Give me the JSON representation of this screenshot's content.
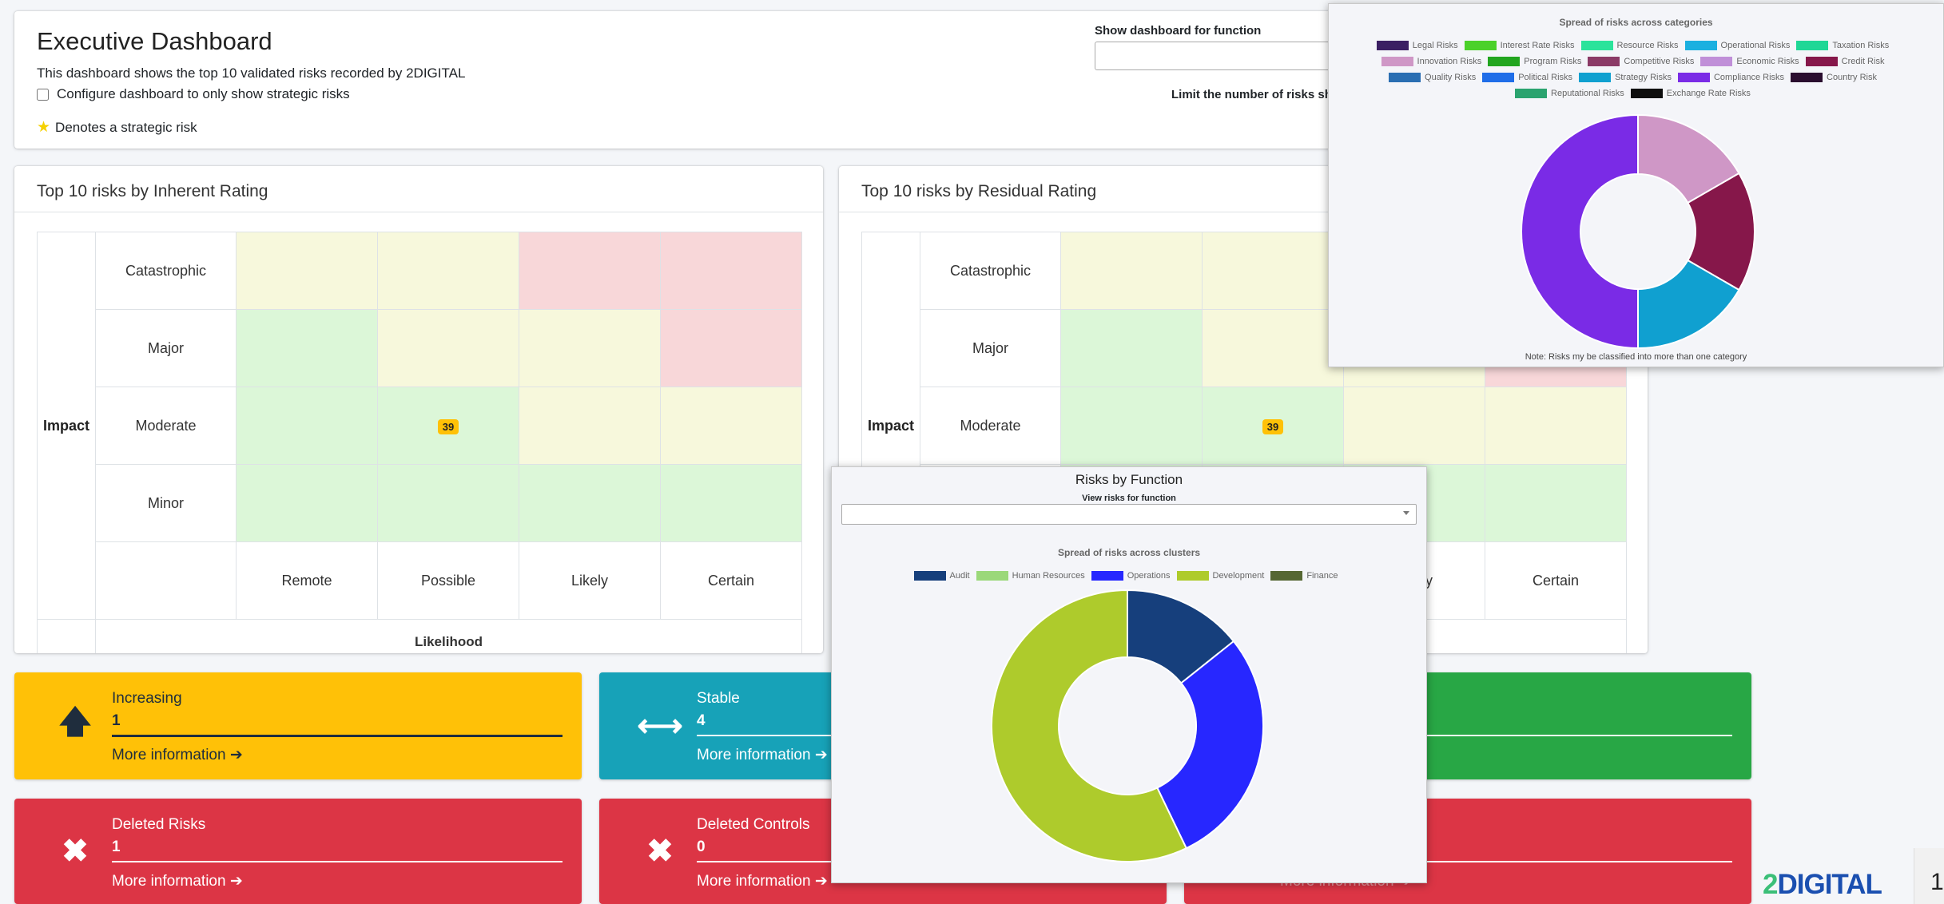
{
  "header": {
    "title": "Executive Dashboard",
    "description": "This dashboard shows the top 10 validated risks recorded by 2DIGITAL",
    "config_label": "Configure dashboard to only show strategic risks",
    "star_note": "Denotes a strategic risk",
    "function_label": "Show dashboard for function",
    "limit_label": "Limit the number of risks show"
  },
  "matrix": {
    "impact_label": "Impact",
    "likelihood_label": "Likelihood",
    "impact_levels": [
      "Catastrophic",
      "Major",
      "Moderate",
      "Minor"
    ],
    "likelihood_levels": [
      "Remote",
      "Possible",
      "Likely",
      "Certain"
    ],
    "ratings": [
      [
        "med",
        "med",
        "high",
        "high"
      ],
      [
        "low",
        "med",
        "med",
        "high"
      ],
      [
        "low",
        "low",
        "med",
        "med"
      ],
      [
        "low",
        "low",
        "low",
        "low"
      ]
    ],
    "colors": {
      "low": "#dcf7d8",
      "med": "#f7f8dc",
      "high": "#f8d7d9"
    }
  },
  "inherent": {
    "title": "Top 10 risks by Inherent Rating",
    "badge": {
      "row": 2,
      "col": 1,
      "value": "39"
    }
  },
  "residual": {
    "title": "Top 10 risks by Residual Rating",
    "badge": {
      "row": 2,
      "col": 1,
      "value": "39"
    }
  },
  "tiles": {
    "increasing": {
      "name": "Increasing",
      "count": "1",
      "more": "More information",
      "icon": "arrow-up-icon"
    },
    "stable": {
      "name": "Stable",
      "count": "4",
      "more": "More information",
      "icon": "arrows-horizontal-icon"
    },
    "deleted_risks": {
      "name": "Deleted Risks",
      "count": "1",
      "more": "More information",
      "icon": "close-icon"
    },
    "deleted_controls": {
      "name": "Deleted Controls",
      "count": "0",
      "more": "More information",
      "icon": "close-icon"
    },
    "partial_more": "More information"
  },
  "brand": {
    "logo_two": "2",
    "logo_text": "DIGITAL",
    "page_number": "1"
  },
  "category_popup": {
    "title": "Spread of risks across categories",
    "note": "Note: Risks my be classified into more than one category",
    "legend": [
      {
        "name": "Legal Risks",
        "color": "#3b1f63"
      },
      {
        "name": "Interest Rate Risks",
        "color": "#4bd12a"
      },
      {
        "name": "Resource Risks",
        "color": "#2be39b"
      },
      {
        "name": "Operational Risks",
        "color": "#1bb0e0"
      },
      {
        "name": "Taxation Risks",
        "color": "#1fd796"
      },
      {
        "name": "Innovation Risks",
        "color": "#cf97c6"
      },
      {
        "name": "Program Risks",
        "color": "#22a51f"
      },
      {
        "name": "Competitive Risks",
        "color": "#8b3a66"
      },
      {
        "name": "Economic Risks",
        "color": "#c08fd8"
      },
      {
        "name": "Credit Risk",
        "color": "#86174a"
      },
      {
        "name": "Quality Risks",
        "color": "#2a6eb2"
      },
      {
        "name": "Political Risks",
        "color": "#1f6de8"
      },
      {
        "name": "Strategy Risks",
        "color": "#10a0d0"
      },
      {
        "name": "Compliance Risks",
        "color": "#7a2be6"
      },
      {
        "name": "Country Risk",
        "color": "#2a0d2f"
      },
      {
        "name": "Reputational Risks",
        "color": "#2aa36f"
      },
      {
        "name": "Exchange Rate Risks",
        "color": "#0e0e0e"
      }
    ]
  },
  "function_popup": {
    "title": "Risks by Function",
    "select_label": "View risks for function",
    "chart_title": "Spread of risks across clusters",
    "legend": [
      {
        "name": "Audit",
        "color": "#163f7c"
      },
      {
        "name": "Human Resources",
        "color": "#9bd87a"
      },
      {
        "name": "Operations",
        "color": "#2727ff"
      },
      {
        "name": "Development",
        "color": "#aecb2c"
      },
      {
        "name": "Finance",
        "color": "#566733"
      }
    ]
  },
  "chart_data": [
    {
      "type": "pie",
      "title": "Spread of risks across categories",
      "categories": [
        "Innovation Risks",
        "Credit Risk",
        "Strategy Risks",
        "Compliance Risks"
      ],
      "values": [
        1,
        1,
        1,
        3
      ],
      "colors": [
        "#cf97c6",
        "#86174a",
        "#10a0d0",
        "#7a2be6"
      ]
    },
    {
      "type": "pie",
      "title": "Spread of risks across clusters",
      "categories": [
        "Audit",
        "Operations",
        "Development"
      ],
      "values": [
        1,
        2,
        4
      ],
      "colors": [
        "#163f7c",
        "#2727ff",
        "#aecb2c"
      ]
    }
  ]
}
